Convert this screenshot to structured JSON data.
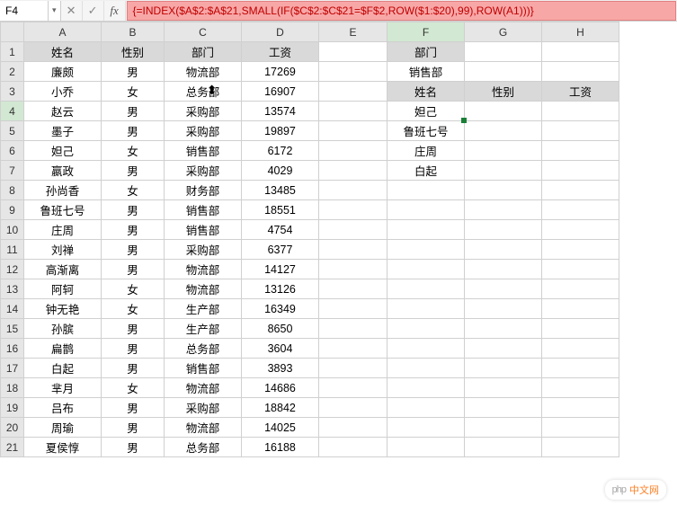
{
  "name_box": "F4",
  "formula": "{=INDEX($A$2:$A$21,SMALL(IF($C$2:$C$21=$F$2,ROW($1:$20),99),ROW(A1)))}",
  "columns": [
    "A",
    "B",
    "C",
    "D",
    "E",
    "F",
    "G",
    "H"
  ],
  "active_cell": "F4",
  "active_col": "F",
  "active_row": "4",
  "main_headers": {
    "name": "姓名",
    "gender": "性别",
    "dept": "部门",
    "salary": "工资"
  },
  "main_rows": [
    {
      "name": "廉颇",
      "gender": "男",
      "dept": "物流部",
      "salary": "17269"
    },
    {
      "name": "小乔",
      "gender": "女",
      "dept": "总务部",
      "salary": "16907",
      "cursor": true
    },
    {
      "name": "赵云",
      "gender": "男",
      "dept": "采购部",
      "salary": "13574"
    },
    {
      "name": "墨子",
      "gender": "男",
      "dept": "采购部",
      "salary": "19897"
    },
    {
      "name": "妲己",
      "gender": "女",
      "dept": "销售部",
      "salary": "6172"
    },
    {
      "name": "嬴政",
      "gender": "男",
      "dept": "采购部",
      "salary": "4029"
    },
    {
      "name": "孙尚香",
      "gender": "女",
      "dept": "财务部",
      "salary": "13485"
    },
    {
      "name": "鲁班七号",
      "gender": "男",
      "dept": "销售部",
      "salary": "18551"
    },
    {
      "name": "庄周",
      "gender": "男",
      "dept": "销售部",
      "salary": "4754"
    },
    {
      "name": "刘禅",
      "gender": "男",
      "dept": "采购部",
      "salary": "6377"
    },
    {
      "name": "高渐离",
      "gender": "男",
      "dept": "物流部",
      "salary": "14127"
    },
    {
      "name": "阿轲",
      "gender": "女",
      "dept": "物流部",
      "salary": "13126"
    },
    {
      "name": "钟无艳",
      "gender": "女",
      "dept": "生产部",
      "salary": "16349"
    },
    {
      "name": "孙膑",
      "gender": "男",
      "dept": "生产部",
      "salary": "8650"
    },
    {
      "name": "扁鹊",
      "gender": "男",
      "dept": "总务部",
      "salary": "3604"
    },
    {
      "name": "白起",
      "gender": "男",
      "dept": "销售部",
      "salary": "3893"
    },
    {
      "name": "芈月",
      "gender": "女",
      "dept": "物流部",
      "salary": "14686"
    },
    {
      "name": "吕布",
      "gender": "男",
      "dept": "采购部",
      "salary": "18842"
    },
    {
      "name": "周瑜",
      "gender": "男",
      "dept": "物流部",
      "salary": "14025"
    },
    {
      "name": "夏侯惇",
      "gender": "男",
      "dept": "总务部",
      "salary": "16188"
    }
  ],
  "lookup": {
    "dept_label": "部门",
    "dept_value": "销售部",
    "name_label": "姓名",
    "gender_label": "性别",
    "salary_label": "工资",
    "results": [
      "妲己",
      "鲁班七号",
      "庄周",
      "白起"
    ]
  },
  "watermark": {
    "badge_prefix": "php",
    "badge_text": "中文网"
  }
}
